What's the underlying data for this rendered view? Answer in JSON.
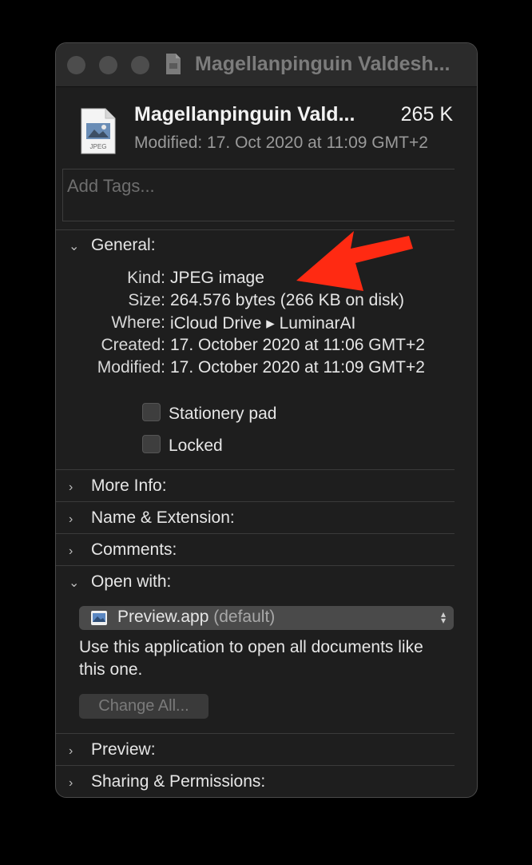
{
  "titlebar": {
    "title": "Magellanpinguin Valdesh..."
  },
  "header": {
    "filename": "Magellanpinguin Vald...",
    "size": "265 K",
    "modified": "Modified: 17. Oct 2020 at 11:09 GMT+2",
    "icon_label": "JPEG"
  },
  "tags": {
    "placeholder": "Add Tags..."
  },
  "general": {
    "label": "General:",
    "rows": [
      {
        "key": "Kind:",
        "value": "JPEG image"
      },
      {
        "key": "Size:",
        "value": "264.576 bytes (266 KB on disk)"
      },
      {
        "key": "Where:",
        "value": "iCloud Drive ▸ LuminarAI"
      },
      {
        "key": "Created:",
        "value": "17. October 2020 at 11:06 GMT+2"
      },
      {
        "key": "Modified:",
        "value": "17. October 2020 at 11:09 GMT+2"
      }
    ],
    "stationery_label": "Stationery pad",
    "locked_label": "Locked"
  },
  "sections": {
    "more_info": "More Info:",
    "name_ext": "Name & Extension:",
    "comments": "Comments:",
    "open_with": "Open with:",
    "preview": "Preview:",
    "sharing": "Sharing & Permissions:"
  },
  "open_with": {
    "app": "Preview.app",
    "default_suffix": "(default)",
    "description": "Use this application to open all documents like this one.",
    "change_all": "Change All..."
  },
  "colors": {
    "annotation_arrow": "#ff2a12",
    "window_bg": "#1e1e1e"
  }
}
